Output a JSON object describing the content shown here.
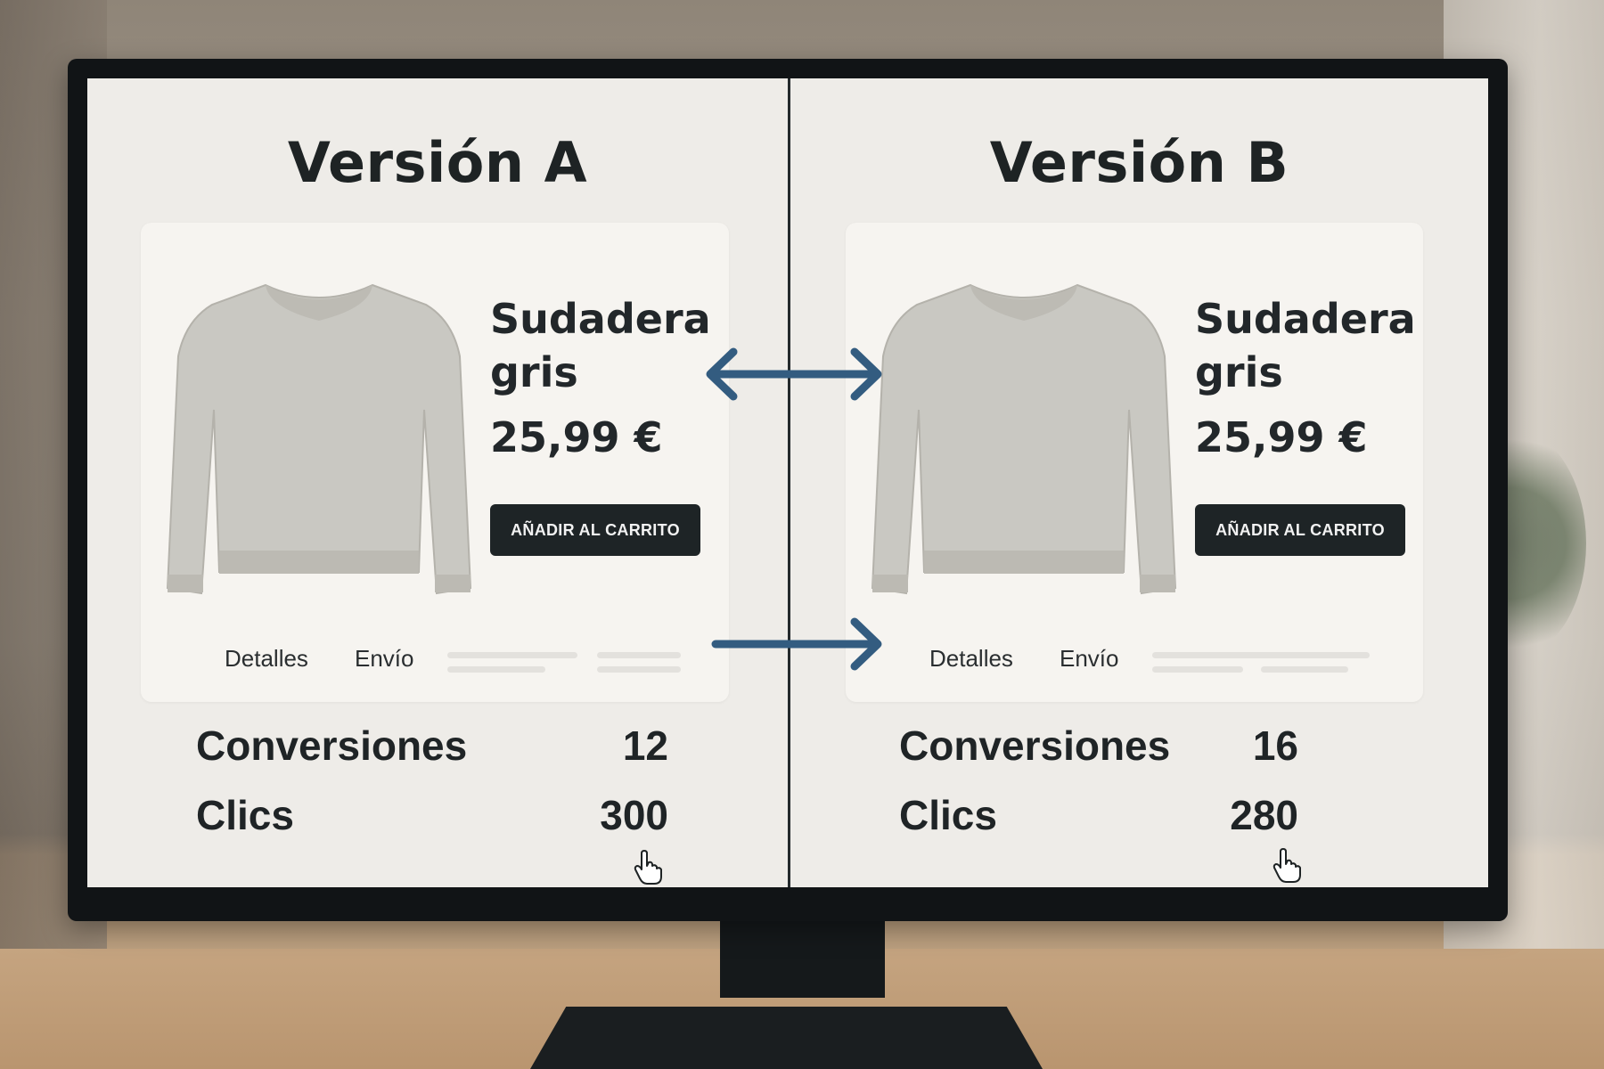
{
  "variants": [
    {
      "title": "Versión A",
      "product_name": "Sudadera gris",
      "price": "25,99 €",
      "cart_button_label": "AÑADIR AL CARRITO",
      "tabs": [
        "Detalles",
        "Envío"
      ],
      "metrics": [
        {
          "label": "Conversiones",
          "value": "12"
        },
        {
          "label": "Clics",
          "value": "300"
        }
      ]
    },
    {
      "title": "Versión B",
      "product_name": "Sudadera gris",
      "price": "25,99 €",
      "cart_button_label": "AÑADIR AL CARRITO",
      "tabs": [
        "Detalles",
        "Envío"
      ],
      "metrics": [
        {
          "label": "Conversiones",
          "value": "16"
        },
        {
          "label": "Clics",
          "value": "280"
        }
      ]
    }
  ],
  "icons": [
    "sweater-image",
    "double-arrow-icon",
    "right-arrow-icon",
    "hand-pointer-icon"
  ],
  "colors": {
    "arrow": "#335c80",
    "button": "#1e2426",
    "screen": "#eeece8",
    "text": "#1e2324"
  }
}
